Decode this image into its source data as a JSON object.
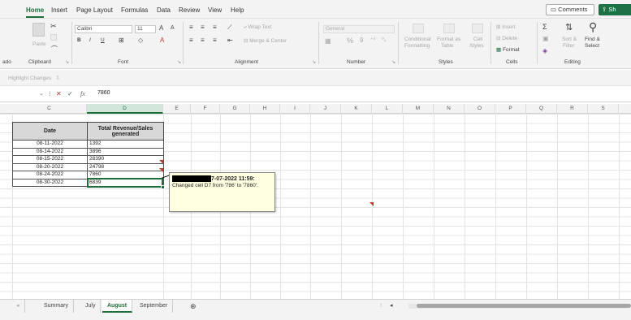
{
  "tabs": [
    "Home",
    "Insert",
    "Page Layout",
    "Formulas",
    "Data",
    "Review",
    "View",
    "Help"
  ],
  "active_tab": "Home",
  "top_buttons": {
    "comments": "Comments",
    "share": "Sh"
  },
  "ribbon": {
    "clipboard": {
      "paste": "Paste",
      "label": "Clipboard",
      "left_label": "ado"
    },
    "font": {
      "name": "Calibri",
      "size": "11",
      "grow": "A",
      "shrink": "A",
      "bold": "B",
      "italic": "I",
      "underline": "U",
      "label": "Font"
    },
    "alignment": {
      "wrap_text": "Wrap Text",
      "merge_center": "Merge & Center",
      "label": "Alignment"
    },
    "number": {
      "format": "General",
      "percent": "%",
      "comma": "9",
      "label": "Number"
    },
    "styles": {
      "conditional": "Conditional",
      "conditional2": "Formatting",
      "format_as": "Format as",
      "format_as2": "Table",
      "cell": "Cell",
      "cell2": "Styles",
      "label": "Styles"
    },
    "cells": {
      "insert": "Insert",
      "delete": "Delete",
      "format": "Format",
      "label": "Cells"
    },
    "editing": {
      "sigma": "Σ",
      "sort": "Sort &",
      "sort2": "Filter",
      "find": "Find &",
      "find2": "Select",
      "label": "Editing"
    }
  },
  "highlight_bar": {
    "text": "Highlight Changes"
  },
  "formula_bar": {
    "cancel": "✕",
    "enter": "✓",
    "fx": "fx",
    "value": "7860"
  },
  "columns": [
    "C",
    "D",
    "E",
    "F",
    "G",
    "H",
    "I",
    "J",
    "K",
    "L",
    "M",
    "N",
    "O",
    "P",
    "Q",
    "R",
    "S"
  ],
  "selected_column": "D",
  "table": {
    "headers": [
      "Date",
      "Total Revenue/Sales generated"
    ],
    "rows": [
      [
        "08-11-2022",
        "1392"
      ],
      [
        "08-14-2022",
        "3896"
      ],
      [
        "08-15-2022",
        "28390"
      ],
      [
        "08-20-2022",
        "24798"
      ],
      [
        "08-24-2022",
        "7860"
      ],
      [
        "08-30-2022",
        "6839"
      ]
    ]
  },
  "comment": {
    "head_suffix": "7-07-2022 11:59:",
    "body": "Changed cell D7 from '786' to '7860'."
  },
  "sheets": [
    "Summary",
    "July",
    "August",
    "September"
  ],
  "active_sheet": "August",
  "colors": {
    "accent": "#1e6e3a",
    "share_button": "#1e7145",
    "comment_bg": "#ffffe1",
    "change_marker": "#c0392b"
  }
}
